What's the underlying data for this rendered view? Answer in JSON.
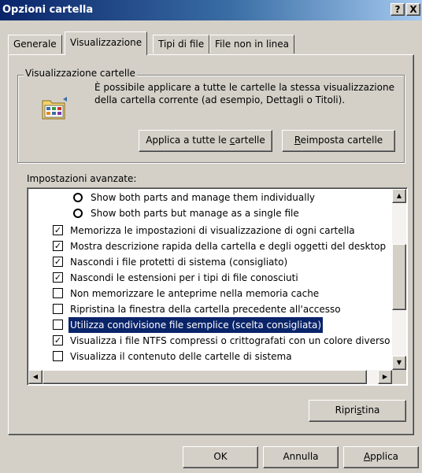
{
  "window": {
    "title": "Opzioni cartella",
    "help_label": "?",
    "close_label": "X"
  },
  "tabs": [
    {
      "label": "Generale"
    },
    {
      "label": "Visualizzazione"
    },
    {
      "label": "Tipi di file"
    },
    {
      "label": "File non in linea"
    }
  ],
  "folder_views": {
    "group_label": "Visualizzazione cartelle",
    "description": "È possibile applicare a tutte le cartelle la stessa visualizzazione della cartella corrente (ad esempio, Dettagli o Titoli).",
    "apply_all_pre": "Applica a tutte le ",
    "apply_all_key": "c",
    "apply_all_post": "artelle",
    "reset_key": "R",
    "reset_post": "eimposta cartelle"
  },
  "advanced": {
    "label": "Impostazioni avanzate:",
    "items": [
      {
        "type": "radio",
        "checked": false,
        "label": "Show both parts and manage them individually"
      },
      {
        "type": "radio",
        "checked": false,
        "label": "Show both parts but manage as a single file"
      },
      {
        "type": "checkbox",
        "checked": true,
        "label": "Memorizza le impostazioni di visualizzazione di ogni cartella"
      },
      {
        "type": "checkbox",
        "checked": true,
        "label": "Mostra descrizione rapida della cartella e degli oggetti del desktop"
      },
      {
        "type": "checkbox",
        "checked": true,
        "label": "Nascondi i file protetti di sistema (consigliato)"
      },
      {
        "type": "checkbox",
        "checked": true,
        "label": "Nascondi le estensioni per i tipi di file conosciuti"
      },
      {
        "type": "checkbox",
        "checked": false,
        "label": "Non memorizzare le anteprime nella memoria cache"
      },
      {
        "type": "checkbox",
        "checked": false,
        "label": "Ripristina la finestra della cartella precedente all'accesso"
      },
      {
        "type": "checkbox",
        "checked": false,
        "selected": true,
        "label": "Utilizza condivisione file semplice (scelta consigliata)"
      },
      {
        "type": "checkbox",
        "checked": true,
        "label": "Visualizza i file NTFS compressi o crittografati con un colore diverso"
      },
      {
        "type": "checkbox",
        "checked": false,
        "label": "Visualizza il contenuto delle cartelle di sistema"
      }
    ]
  },
  "restore": {
    "pre": "Ripri",
    "key": "s",
    "post": "tina"
  },
  "dialog_buttons": {
    "ok": "OK",
    "cancel": "Annulla",
    "apply_key": "A",
    "apply_post": "pplica"
  },
  "colors": {
    "title_start": "#0a246a",
    "title_end": "#a6caf0",
    "face": "#d4d0c8",
    "selection": "#0a246a"
  },
  "icons": {
    "folder": "folder-view-icon",
    "check": "check-mark",
    "scroll_up": "up-arrow",
    "scroll_down": "down-arrow",
    "scroll_left": "left-arrow",
    "scroll_right": "right-arrow"
  }
}
